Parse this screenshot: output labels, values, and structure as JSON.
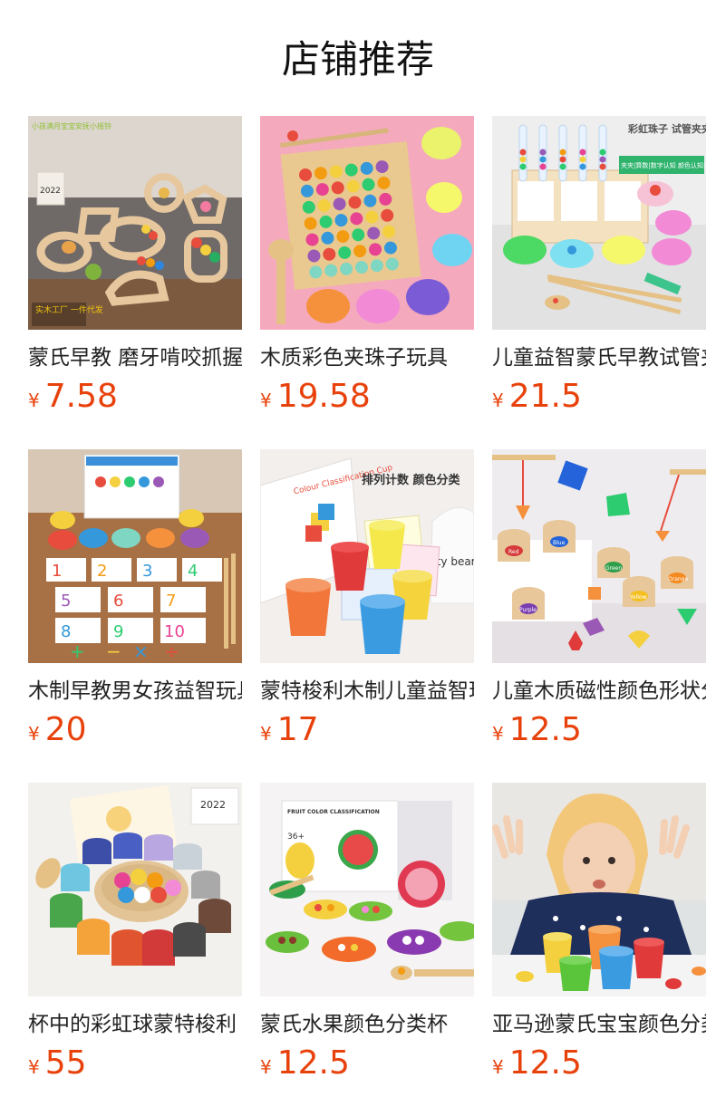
{
  "page": {
    "title": "店铺推荐"
  },
  "theme": {
    "price_color": "#e8420c"
  },
  "products": [
    {
      "name": "蒙氏早教 磨牙啃咬抓握玩具",
      "currency": "¥",
      "price": "7.58",
      "image": "wooden-rattle-teethers-photo",
      "overlay_top": "小孩满月宝宝安抚小摇铃",
      "overlay_bottom": "实木工厂 一件代发"
    },
    {
      "name": "木质彩色夹珠子玩具",
      "currency": "¥",
      "price": "19.58",
      "image": "bead-clip-board-photo"
    },
    {
      "name": "儿童益智蒙氏早教试管夹珠子",
      "currency": "¥",
      "price": "21.5",
      "image": "rainbow-bead-test-tube-photo",
      "overlay_top": "彩虹珠子 试管夹夹乐",
      "overlay_bottom": "夹夹|算数|数字认知 颜色认知|锻炼手眼协调"
    },
    {
      "name": "木制早教男女孩益智玩具",
      "currency": "¥",
      "price": "20",
      "image": "number-cards-bead-cups-photo"
    },
    {
      "name": "蒙特梭利木制儿童益智玩具",
      "currency": "¥",
      "price": "17",
      "image": "colour-classification-cups-photo",
      "overlay_top": "排列计数 颜色分类",
      "box_text": "Colour Classification Cup",
      "bag_text": "tty bear"
    },
    {
      "name": "儿童木质磁性颜色形状分类",
      "currency": "¥",
      "price": "12.5",
      "image": "magnetic-color-shape-sorter-photo",
      "cup_labels": [
        "Red",
        "Blue",
        "Green",
        "Yellow",
        "Orange",
        "Purple"
      ]
    },
    {
      "name": "杯中的彩虹球蒙特梭利",
      "currency": "¥",
      "price": "55",
      "image": "rainbow-balls-in-cups-photo",
      "calendar_text": "2022"
    },
    {
      "name": "蒙氏水果颜色分类杯",
      "currency": "¥",
      "price": "12.5",
      "image": "fruit-color-classification-photo",
      "box_text": "FRUIT COLOR CLASSIFICATION",
      "age_text": "36+"
    },
    {
      "name": "亚马逊蒙氏宝宝颜色分类杯",
      "currency": "¥",
      "price": "12.5",
      "image": "child-playing-color-cups-photo"
    }
  ]
}
